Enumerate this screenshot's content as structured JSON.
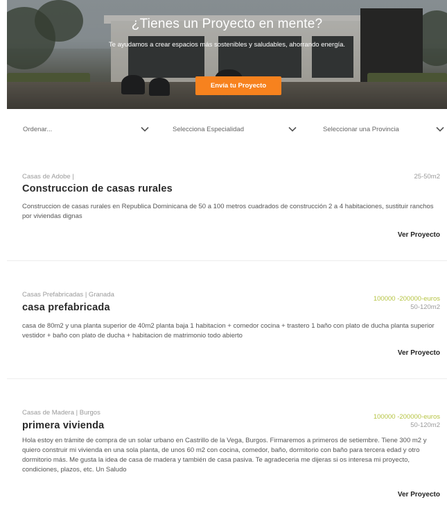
{
  "hero": {
    "title": "¿Tienes un Proyecto en mente?",
    "subtitle": "Te ayudamos a crear espacios más sostenibles y saludables, ahorrando energía.",
    "cta_label": "Envía tu Proyecto",
    "cta_color": "#f7821e"
  },
  "filters": [
    {
      "label": "Ordenar...",
      "icon": "chevron-down-icon"
    },
    {
      "label": "Selecciona Especialidad",
      "icon": "chevron-down-icon"
    },
    {
      "label": "Seleccionar una Provincia",
      "icon": "chevron-down-icon"
    }
  ],
  "projects": [
    {
      "meta": "Casas de Adobe |",
      "title": "Construccion de casas rurales",
      "budget": "",
      "size": "25-50m2",
      "description": "Construccion de casas rurales en Republica Dominicana de 50 a 100 metros cuadrados de construcción 2 a 4 habitaciones, sustituir ranchos por viviendas dignas",
      "link_label": "Ver Proyecto"
    },
    {
      "meta": "Casas Prefabricadas | Granada",
      "title": "casa prefabricada",
      "budget": "100000 -200000-euros",
      "size": "50-120m2",
      "description": "casa de 80m2 y una planta superior de 40m2 planta baja 1 habitacion + comedor cocina + trastero 1 baño con plato de ducha planta superior vestidor + baño con plato de ducha + habitacion de matrimonio todo abierto",
      "link_label": "Ver Proyecto"
    },
    {
      "meta": "Casas de Madera | Burgos",
      "title": "primera vivienda",
      "budget": "100000 -200000-euros",
      "size": "50-120m2",
      "description": "Hola estoy en trámite de compra de un solar urbano en Castrillo de la Vega, Burgos. Firmaremos a primeros de setiembre. Tiene 300 m2 y quiero construir mi vivienda en una sola planta, de unos 60 m2 con cocina, comedor, baño, dormitorio con baño para tercera edad y otro dormitorio más. Me gusta la idea de casa de madera y también de casa pasiva. Te agradeceria me dijeras si os interesa mi proyecto, condiciones, plazos, etc. Un Saludo",
      "link_label": "Ver Proyecto"
    }
  ],
  "colors": {
    "budget": "#b6c444",
    "accent": "#f7821e"
  }
}
